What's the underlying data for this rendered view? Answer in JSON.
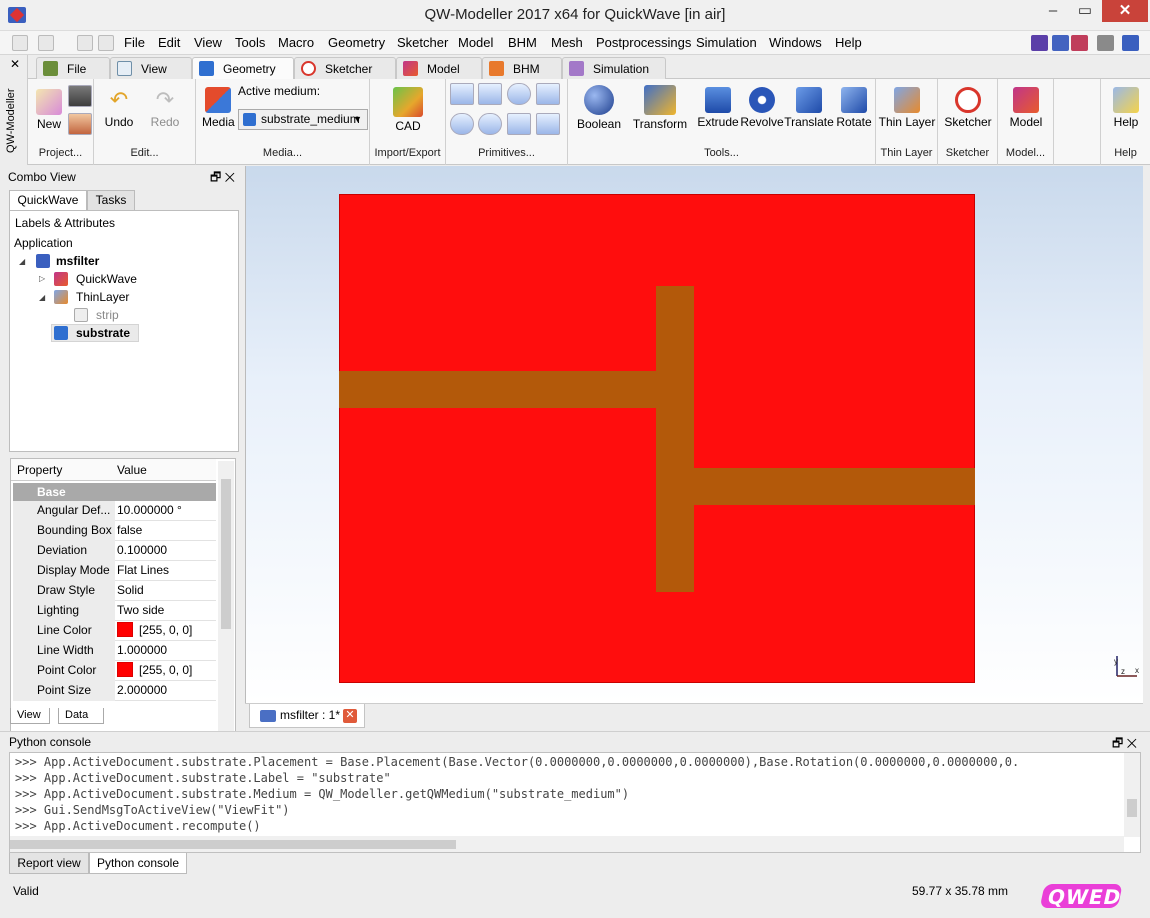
{
  "window": {
    "title": "QW-Modeller 2017 x64 for QuickWave [in air]",
    "minimize": "–",
    "maximize": "▭",
    "close": "✕"
  },
  "menu": [
    "File",
    "Edit",
    "View",
    "Tools",
    "Macro",
    "Geometry",
    "Sketcher",
    "Model",
    "BHM",
    "Mesh",
    "Postprocessings",
    "Simulation",
    "Windows",
    "Help"
  ],
  "ribbon": {
    "side_label": "QW-Modeller",
    "side_close": "✕",
    "tabs": [
      "File",
      "View",
      "Geometry",
      "Sketcher",
      "Model",
      "BHM",
      "Simulation"
    ],
    "active_tab": "Geometry",
    "project": {
      "new": "New",
      "title": "Project..."
    },
    "edit": {
      "undo": "Undo",
      "redo": "Redo",
      "title": "Edit..."
    },
    "media": {
      "media": "Media",
      "active_medium_label": "Active medium:",
      "active_medium": "substrate_medium",
      "title": "Media..."
    },
    "import_export": {
      "cad": "CAD",
      "title": "Import/Export"
    },
    "primitives": {
      "title": "Primitives..."
    },
    "tools": {
      "boolean": "Boolean",
      "transform": "Transform",
      "extrude": "Extrude",
      "revolve": "Revolve",
      "translate": "Translate",
      "rotate": "Rotate",
      "title": "Tools..."
    },
    "thin_layer": {
      "btn": "Thin Layer",
      "title": "Thin Layer"
    },
    "sketcher": {
      "btn": "Sketcher",
      "title": "Sketcher"
    },
    "model": {
      "btn": "Model",
      "title": "Model..."
    },
    "help": {
      "btn": "Help",
      "title": "Help"
    }
  },
  "combo_view": {
    "title": "Combo View",
    "tabs": [
      "QuickWave",
      "Tasks"
    ],
    "labels_header": "Labels & Attributes",
    "tree": {
      "application": "Application",
      "document": "msfilter",
      "quickwave": "QuickWave",
      "thinlayer": "ThinLayer",
      "strip": "strip",
      "substrate": "substrate"
    },
    "property_header": [
      "Property",
      "Value"
    ],
    "group": "Base",
    "properties": [
      {
        "name": "Angular Def...",
        "value": "10.000000 °"
      },
      {
        "name": "Bounding Box",
        "value": "false"
      },
      {
        "name": "Deviation",
        "value": "0.100000"
      },
      {
        "name": "Display Mode",
        "value": "Flat Lines"
      },
      {
        "name": "Draw Style",
        "value": "Solid"
      },
      {
        "name": "Lighting",
        "value": "Two side"
      },
      {
        "name": "Line Color",
        "value": "[255, 0, 0]"
      },
      {
        "name": "Line Width",
        "value": "1.000000"
      },
      {
        "name": "Point Color",
        "value": "[255, 0, 0]"
      },
      {
        "name": "Point Size",
        "value": "2.000000"
      }
    ],
    "bottom_tabs": [
      "View",
      "Data"
    ]
  },
  "viewport": {
    "substrate_color": "#ff0d0d",
    "strip_color": "#b3590a",
    "doc_tab": "msfilter : 1*"
  },
  "console": {
    "title": "Python console",
    "lines": [
      ">>> App.ActiveDocument.substrate.Placement = Base.Placement(Base.Vector(0.0000000,0.0000000,0.0000000),Base.Rotation(0.0000000,0.0000000,0.",
      ">>> App.ActiveDocument.substrate.Label = \"substrate\"",
      ">>> App.ActiveDocument.substrate.Medium = QW_Modeller.getQWMedium(\"substrate_medium\")",
      ">>> Gui.SendMsgToActiveView(\"ViewFit\")",
      ">>> App.ActiveDocument.recompute()"
    ],
    "tabs": [
      "Report view",
      "Python console"
    ]
  },
  "status": {
    "text": "Valid",
    "dimensions": "59.77 x 35.78 mm",
    "logo": "QWED"
  }
}
